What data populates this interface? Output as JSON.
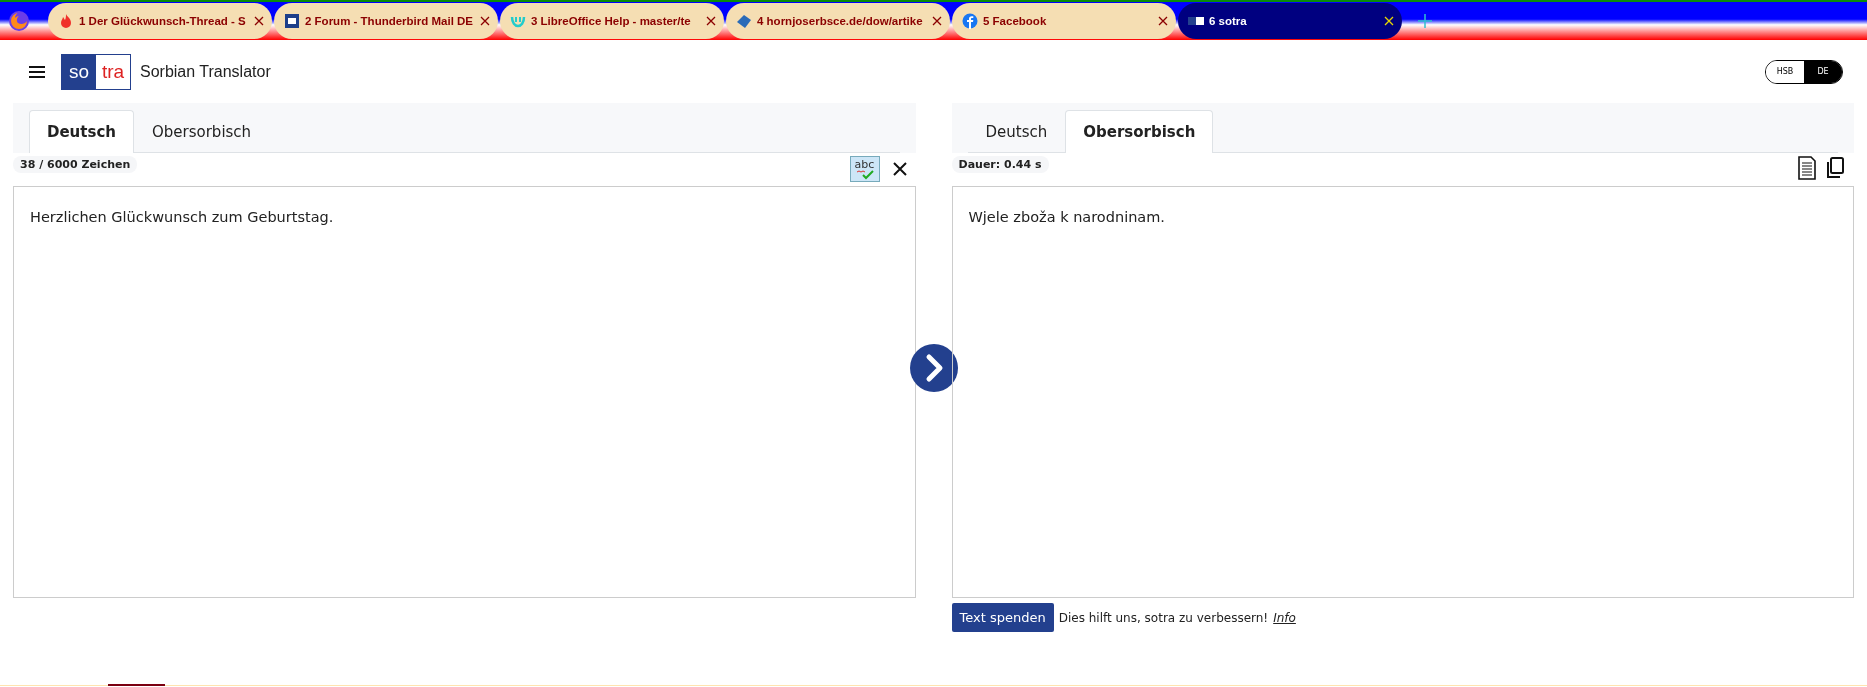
{
  "browser_tabs": [
    {
      "title": "1 Der Glückwunsch-Thread - S",
      "selected": false
    },
    {
      "title": "2 Forum - Thunderbird Mail DE",
      "selected": false
    },
    {
      "title": "3 LibreOffice Help - master/te",
      "selected": false
    },
    {
      "title": "4 hornjoserbsce.de/dow/artike",
      "selected": false
    },
    {
      "title": "5 Facebook",
      "selected": false
    },
    {
      "title": "6 sotra",
      "selected": true
    }
  ],
  "header": {
    "logo_left": "so",
    "logo_right": "tra",
    "title": "Sorbian Translator"
  },
  "ui_language": [
    {
      "label": "HSB",
      "selected": false
    },
    {
      "label": "DE",
      "selected": true
    }
  ],
  "source": {
    "tabs": [
      {
        "label": "Deutsch",
        "selected": true
      },
      {
        "label": "Obersorbisch",
        "selected": false
      }
    ],
    "counter": "38 / 6000 Zeichen",
    "spellcheck_on": true,
    "spellcheck_label": "abc",
    "text": "Herzlichen Glückwunsch zum Geburtstag."
  },
  "target": {
    "tabs": [
      {
        "label": "Deutsch",
        "selected": false
      },
      {
        "label": "Obersorbisch",
        "selected": true
      }
    ],
    "duration": "Dauer: 0.44 s",
    "text": "Wjele zboža k narodninam."
  },
  "donate": {
    "button": "Text spenden",
    "message": "Dies hilft uns, sotra zu verbessern!",
    "link": "Info"
  }
}
